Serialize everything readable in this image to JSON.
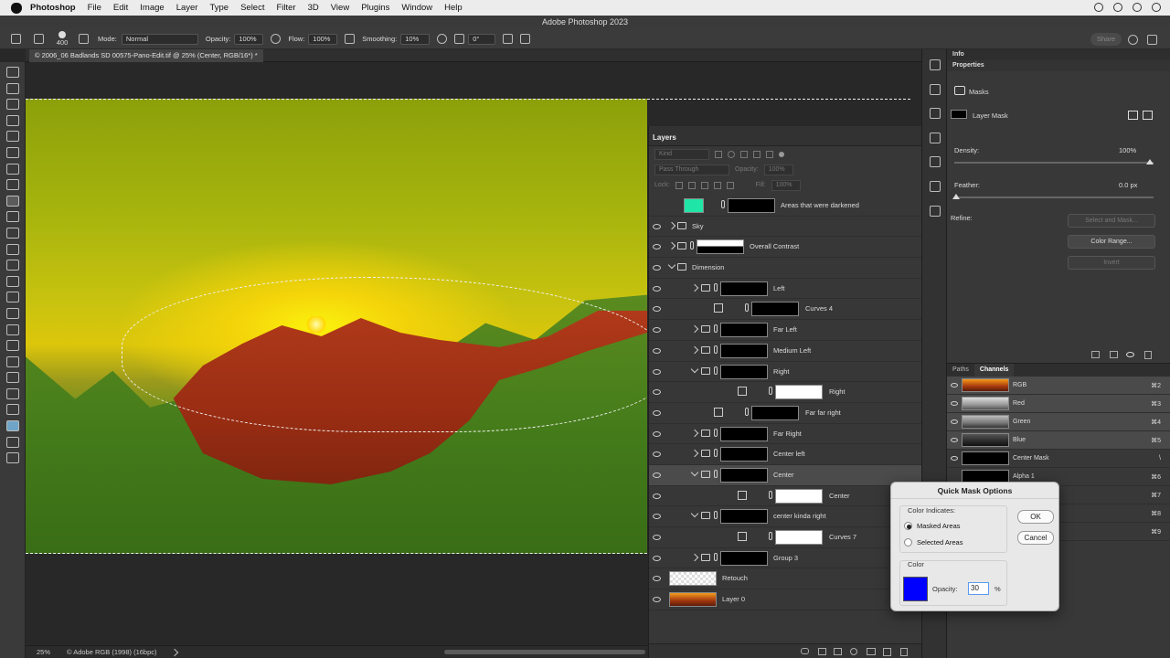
{
  "menubar": {
    "app": "Photoshop",
    "items": [
      "File",
      "Edit",
      "Image",
      "Layer",
      "Type",
      "Select",
      "Filter",
      "3D",
      "View",
      "Plugins",
      "Window",
      "Help"
    ]
  },
  "window_title": "Adobe Photoshop 2023",
  "options": {
    "brush_size": "400",
    "mode_label": "Mode:",
    "mode_value": "Normal",
    "opacity_label": "Opacity:",
    "opacity_value": "100%",
    "flow_label": "Flow:",
    "flow_value": "100%",
    "smoothing_label": "Smoothing:",
    "smoothing_value": "10%",
    "angle": "0°",
    "share": "Share"
  },
  "document_tab": "© 2006_06 Badlands SD 00575-Pano-Edit.tif @ 25% (Center, RGB/16*) *",
  "status": {
    "zoom": "25%",
    "profile": "© Adobe RGB (1998) (16bpc)"
  },
  "layers_panel": {
    "title": "Layers",
    "kind": "Kind",
    "blend": "Pass Through",
    "opacity": "Opacity:",
    "opacity_value": "100%",
    "lock": "Lock:",
    "fill": "Fill:",
    "fill_value": "100%",
    "rows": [
      {
        "name": "Areas that were darkened"
      },
      {
        "name": "Sky"
      },
      {
        "name": "Overall Contrast"
      },
      {
        "name": "Dimension"
      },
      {
        "name": "Left"
      },
      {
        "name": "Curves 4"
      },
      {
        "name": "Far Left"
      },
      {
        "name": "Medium Left"
      },
      {
        "name": "Right"
      },
      {
        "name": "Right"
      },
      {
        "name": "Far far right"
      },
      {
        "name": "Far Right"
      },
      {
        "name": "Center left"
      },
      {
        "name": "Center"
      },
      {
        "name": "Center"
      },
      {
        "name": "center kinda right"
      },
      {
        "name": "Curves 7"
      },
      {
        "name": "Group 3"
      },
      {
        "name": "Retouch"
      },
      {
        "name": "Layer 0"
      }
    ]
  },
  "properties": {
    "info_tab": "Info",
    "title": "Properties",
    "masks": "Masks",
    "layer_mask": "Layer Mask",
    "density_label": "Density:",
    "density_value": "100%",
    "density_level": 1.0,
    "feather_label": "Feather:",
    "feather_value": "0.0 px",
    "refine_label": "Refine:",
    "btn_select_mask": "Select and Mask...",
    "btn_color_range": "Color Range...",
    "btn_invert": "Invert"
  },
  "channels_panel": {
    "tabs": [
      "Paths",
      "Channels"
    ],
    "rows": [
      {
        "name": "RGB",
        "key": "⌘2"
      },
      {
        "name": "Red",
        "key": "⌘3"
      },
      {
        "name": "Green",
        "key": "⌘4"
      },
      {
        "name": "Blue",
        "key": "⌘5"
      },
      {
        "name": "Center Mask",
        "key": "\\"
      },
      {
        "name": "Alpha 1",
        "key": "⌘6"
      },
      {
        "name": "",
        "key": "⌘7"
      },
      {
        "name": "",
        "key": "⌘8"
      },
      {
        "name": "",
        "key": "⌘9"
      }
    ]
  },
  "quick_mask": {
    "title": "Quick Mask Options",
    "color_indicates": "Color Indicates:",
    "masked": "Masked Areas",
    "selected": "Selected Areas",
    "color": "Color",
    "opacity_label": "Opacity:",
    "opacity_value": "30",
    "percent": "%",
    "ok": "OK",
    "cancel": "Cancel",
    "swatch_color": "#0000ff"
  }
}
